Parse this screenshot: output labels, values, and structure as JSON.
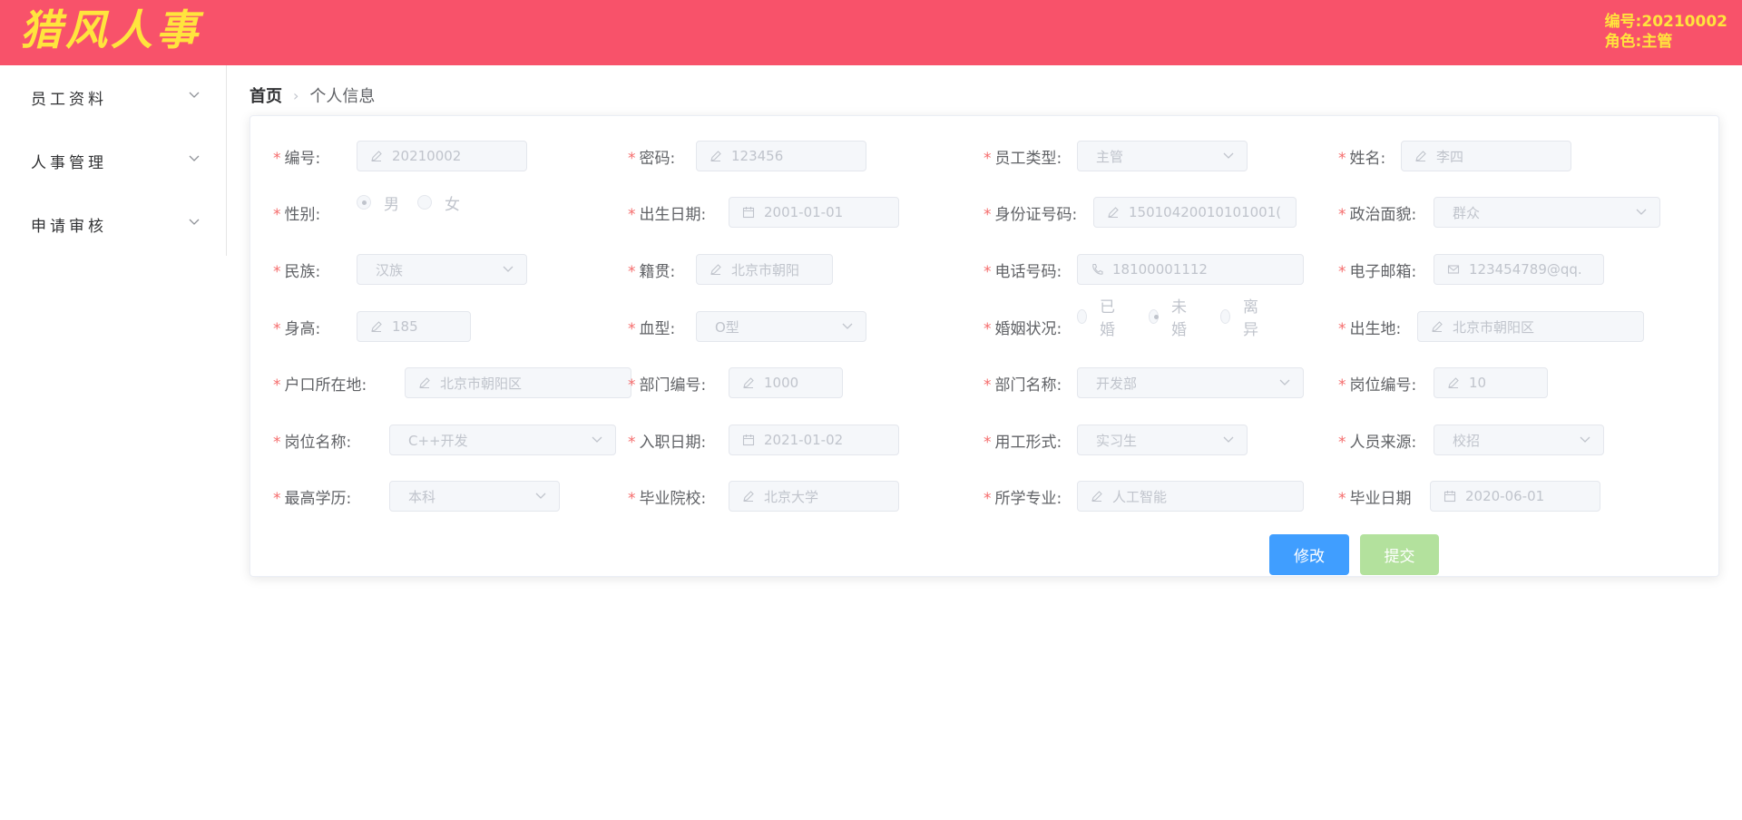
{
  "header": {
    "logo": "猎风人事",
    "id_text": "编号:20210002",
    "role_text": "角色:主管"
  },
  "sidebar": {
    "items": [
      {
        "label": "员工资料"
      },
      {
        "label": "人事管理"
      },
      {
        "label": "申请审核"
      }
    ]
  },
  "breadcrumb": {
    "home": "首页",
    "current": "个人信息"
  },
  "form": {
    "id": {
      "label": "编号:",
      "value": "20210002"
    },
    "password": {
      "label": "密码:",
      "value": "123456"
    },
    "employee_type": {
      "label": "员工类型:",
      "value": "主管"
    },
    "name": {
      "label": "姓名:",
      "value": "李四"
    },
    "gender": {
      "label": "性别:",
      "options": [
        "男",
        "女"
      ],
      "selected": "男"
    },
    "birth_date": {
      "label": "出生日期:",
      "value": "2001-01-01"
    },
    "id_card": {
      "label": "身份证号码:",
      "value": "15010420010101001("
    },
    "politics": {
      "label": "政治面貌:",
      "value": "群众"
    },
    "ethnicity": {
      "label": "民族:",
      "value": "汉族"
    },
    "native_place": {
      "label": "籍贯:",
      "value": "北京市朝阳"
    },
    "phone": {
      "label": "电话号码:",
      "value": "18100001112"
    },
    "email": {
      "label": "电子邮箱:",
      "value": "123454789@qq."
    },
    "height": {
      "label": "身高:",
      "value": "185"
    },
    "blood_type": {
      "label": "血型:",
      "value": "O型"
    },
    "marital": {
      "label": "婚姻状况:",
      "options": [
        "已婚",
        "未婚",
        "离异"
      ],
      "selected": "未婚"
    },
    "birthplace": {
      "label": "出生地:",
      "value": "北京市朝阳区"
    },
    "household": {
      "label": "户口所在地:",
      "value": "北京市朝阳区"
    },
    "dept_id": {
      "label": "部门编号:",
      "value": "1000"
    },
    "dept_name": {
      "label": "部门名称:",
      "value": "开发部"
    },
    "post_id": {
      "label": "岗位编号:",
      "value": "10"
    },
    "post_name": {
      "label": "岗位名称:",
      "value": "C++开发"
    },
    "hire_date": {
      "label": "入职日期:",
      "value": "2021-01-02"
    },
    "employment_form": {
      "label": "用工形式:",
      "value": "实习生"
    },
    "source": {
      "label": "人员来源:",
      "value": "校招"
    },
    "education": {
      "label": "最高学历:",
      "value": "本科"
    },
    "school": {
      "label": "毕业院校:",
      "value": "北京大学"
    },
    "major": {
      "label": "所学专业:",
      "value": "人工智能"
    },
    "grad_date": {
      "label": "毕业日期",
      "value": "2020-06-01"
    }
  },
  "buttons": {
    "edit": "修改",
    "submit": "提交"
  },
  "colors": {
    "header_bg": "#f8526a",
    "logo": "#ffe43d",
    "primary": "#409eff",
    "success_disabled": "#b3e19d",
    "required": "#f56c6c"
  }
}
